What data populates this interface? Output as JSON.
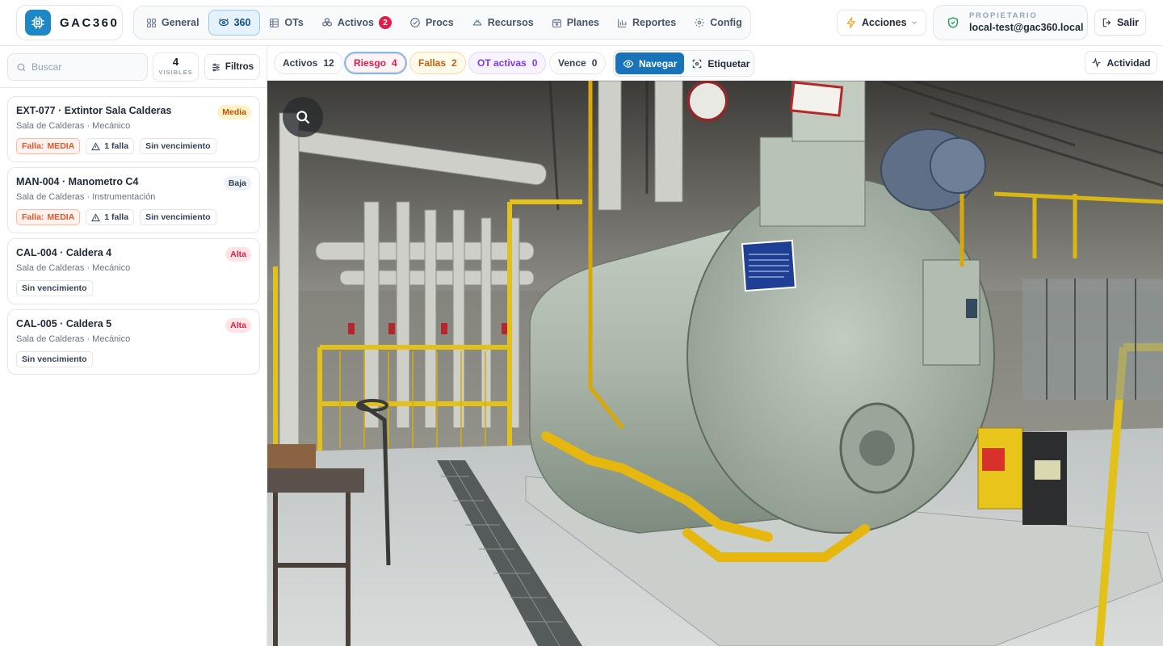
{
  "app": {
    "name": "GAC360"
  },
  "nav": {
    "items": [
      {
        "label": "General",
        "icon": "grid-icon"
      },
      {
        "label": "360",
        "icon": "view-360-icon",
        "active": true
      },
      {
        "label": "OTs",
        "icon": "table-icon"
      },
      {
        "label": "Activos",
        "icon": "boxes-icon",
        "badge": "2"
      },
      {
        "label": "Procs",
        "icon": "check-circle-icon"
      },
      {
        "label": "Recursos",
        "icon": "helmet-icon"
      },
      {
        "label": "Planes",
        "icon": "calendar-icon"
      },
      {
        "label": "Reportes",
        "icon": "bar-chart-icon"
      },
      {
        "label": "Config",
        "icon": "gear-icon"
      }
    ]
  },
  "header": {
    "actions_label": "Acciones",
    "owner_role": "PROPIETARIO",
    "owner_email": "local-test@gac360.local",
    "logout_label": "Salir"
  },
  "sidebar": {
    "search_placeholder": "Buscar",
    "visible_count": "4",
    "visible_label": "VISIBLES",
    "filters_label": "Filtros",
    "assets": [
      {
        "code_name": "EXT-077 · Extintor Sala Calderas",
        "location": "Sala de Calderas · Mecánico",
        "priority": "Media",
        "fault_label": "Falla:",
        "fault_level": "MEDIA",
        "fault_count": "1 falla",
        "due": "Sin vencimiento"
      },
      {
        "code_name": "MAN-004 · Manometro C4",
        "location": "Sala de Calderas · Instrumentación",
        "priority": "Baja",
        "fault_label": "Falla:",
        "fault_level": "MEDIA",
        "fault_count": "1 falla",
        "due": "Sin vencimiento"
      },
      {
        "code_name": "CAL-004 · Caldera 4",
        "location": "Sala de Calderas · Mecánico",
        "priority": "Alta",
        "due": "Sin vencimiento"
      },
      {
        "code_name": "CAL-005 · Caldera 5",
        "location": "Sala de Calderas · Mecánico",
        "priority": "Alta",
        "due": "Sin vencimiento"
      }
    ]
  },
  "filters": {
    "pills": [
      {
        "label": "Activos",
        "count": "12"
      },
      {
        "label": "Riesgo",
        "count": "4"
      },
      {
        "label": "Fallas",
        "count": "2"
      },
      {
        "label": "OT activas",
        "count": "0"
      },
      {
        "label": "Vence",
        "count": "0"
      }
    ],
    "navigate_label": "Navegar",
    "tag_label": "Etiquetar",
    "activity_label": "Actividad"
  },
  "colors": {
    "brand": "#1e88c7",
    "navigate_active": "#1873b9",
    "danger": "#e11d48"
  }
}
